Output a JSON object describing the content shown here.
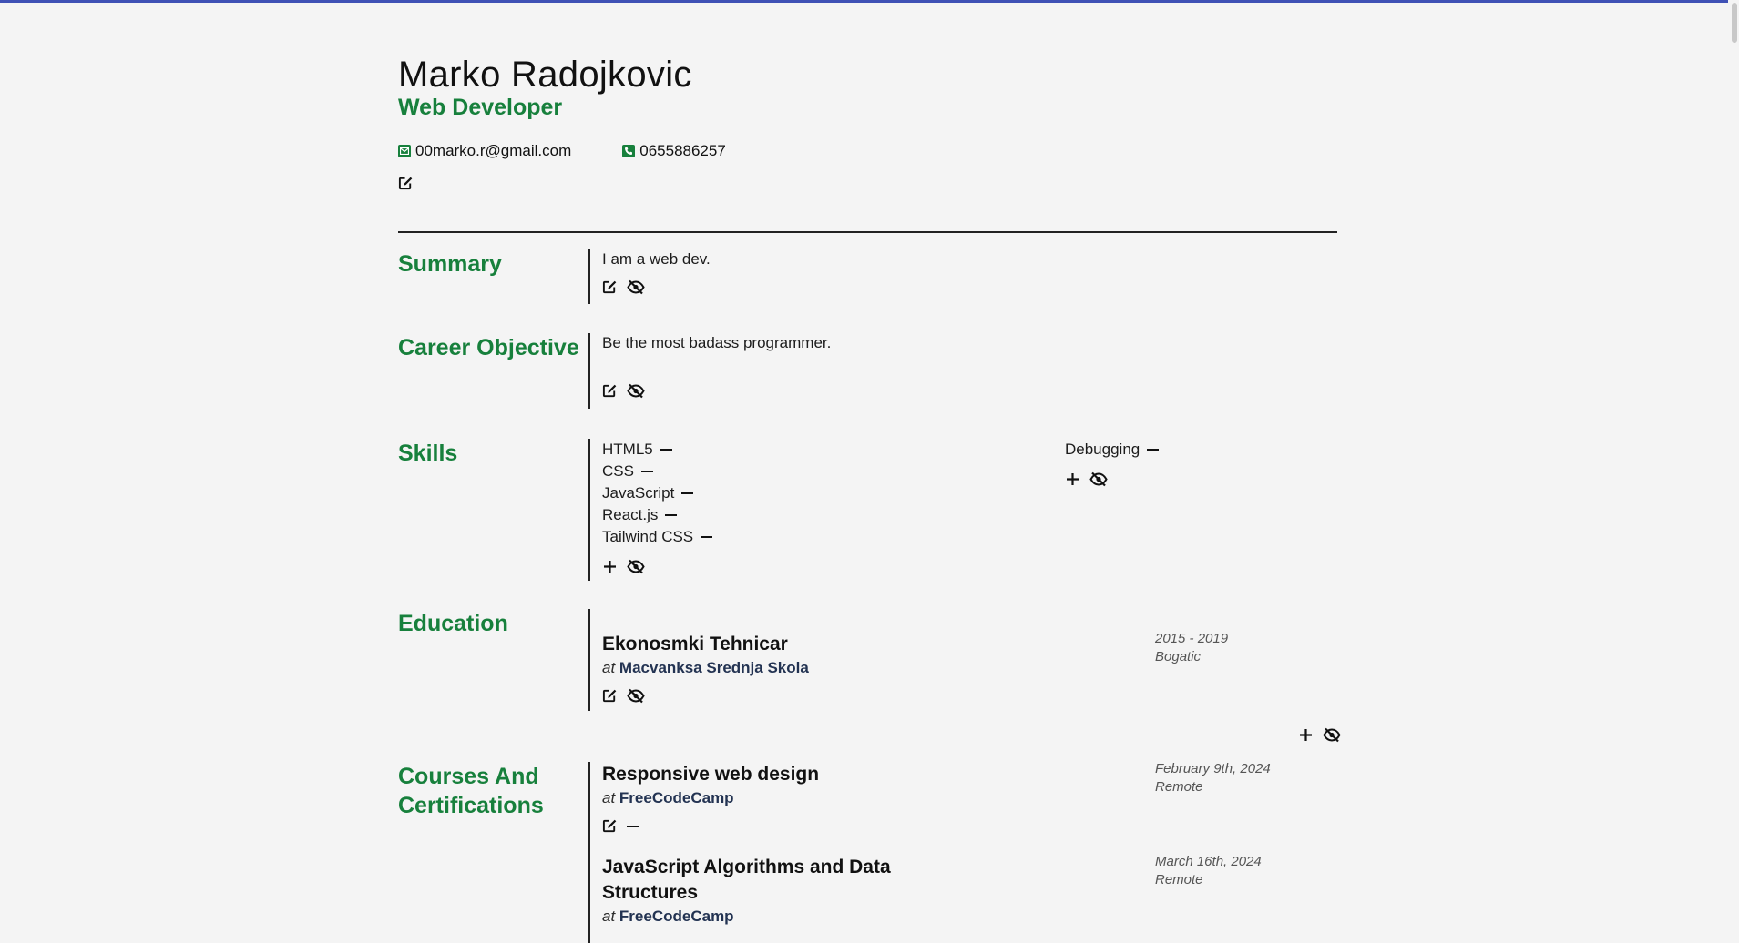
{
  "header": {
    "name": "Marko Radojkovic",
    "role": "Web Developer",
    "email": "00marko.r@gmail.com",
    "phone": "0655886257"
  },
  "sections": {
    "summary": {
      "title": "Summary",
      "text": "I am a web dev."
    },
    "objective": {
      "title": "Career Objective",
      "text": "Be the most badass programmer."
    },
    "skills": {
      "title": "Skills",
      "col1": [
        "HTML5",
        "CSS",
        "JavaScript",
        "React.js",
        "Tailwind CSS"
      ],
      "col2": [
        "Debugging"
      ]
    },
    "education": {
      "title": "Education",
      "items": [
        {
          "title": "Ekonosmki Tehnicar",
          "at": "at",
          "org": "Macvanksa Srednja Skola",
          "dates": "2015 - 2019",
          "location": "Bogatic"
        }
      ]
    },
    "courses": {
      "title": "Courses And Certifications",
      "items": [
        {
          "title": "Responsive web design",
          "at": "at",
          "org": "FreeCodeCamp",
          "dates": "February 9th, 2024",
          "location": "Remote"
        },
        {
          "title": "JavaScript Algorithms and Data Structures",
          "at": "at",
          "org": "FreeCodeCamp",
          "dates": "March 16th, 2024",
          "location": "Remote"
        }
      ]
    }
  },
  "colors": {
    "accent": "#17803c",
    "top_bar": "#3f51b5",
    "org_text": "#233352"
  },
  "icons": [
    "envelope-icon",
    "phone-icon",
    "edit-icon",
    "eye-slash-icon",
    "plus-icon",
    "minus-icon"
  ]
}
